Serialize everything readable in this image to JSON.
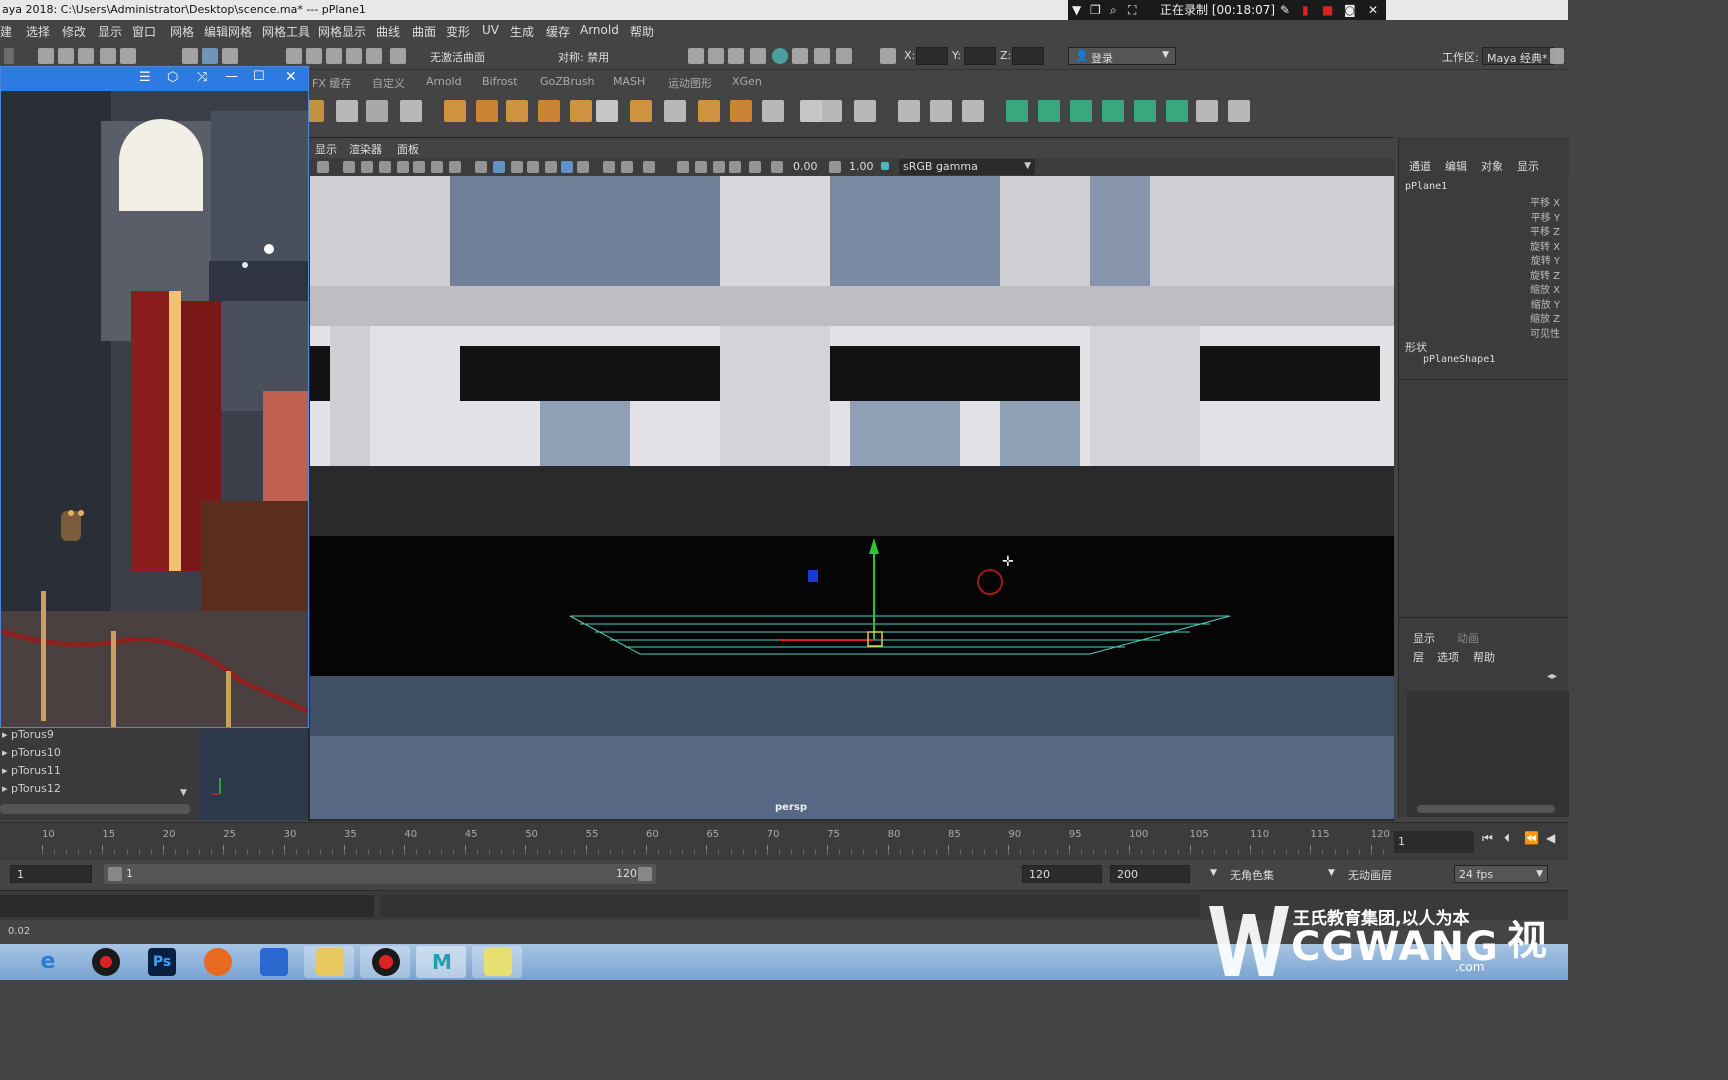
{
  "window": {
    "title": "aya 2018: C:\\Users\\Administrator\\Desktop\\scence.ma*   ---   pPlane1",
    "recording": "正在录制 [00:18:07]"
  },
  "menu": [
    "建",
    "选择",
    "修改",
    "显示",
    "窗口",
    "网格",
    "编辑网格",
    "网格工具",
    "网格显示",
    "曲线",
    "曲面",
    "变形",
    "UV",
    "生成",
    "缓存",
    "Arnold",
    "帮助"
  ],
  "status_line": {
    "no_live_surface": "无激活曲面",
    "symmetry": "对称: 禁用",
    "x_label": "X:",
    "y_label": "Y:",
    "z_label": "Z:",
    "login": "登录",
    "workspace_label": "工作区:",
    "workspace_value": "Maya 经典*"
  },
  "shelf_tabs": [
    "FX 缓存",
    "自定义",
    "Arnold",
    "Bifrost",
    "GoZBrush",
    "MASH",
    "运动图形",
    "XGen"
  ],
  "viewport": {
    "menu": [
      "显示",
      "渲染器",
      "面板"
    ],
    "exposure": "0.00",
    "gamma": "1.00",
    "color_space": "sRGB gamma",
    "camera": "persp"
  },
  "outliner": {
    "items": [
      "pTorus9",
      "pTorus10",
      "pTorus11",
      "pTorus12"
    ]
  },
  "channel_box": {
    "tabs": [
      "通道",
      "编辑",
      "对象",
      "显示"
    ],
    "object": "pPlane1",
    "attributes": [
      "平移 X",
      "平移 Y",
      "平移 Z",
      "旋转 X",
      "旋转 Y",
      "旋转 Z",
      "缩放 X",
      "缩放 Y",
      "缩放 Z",
      "可见性"
    ],
    "shapes_label": "形状",
    "shape_name": "pPlaneShape1",
    "layer_tabs": [
      "显示",
      "动画"
    ],
    "layer_menu": [
      "层",
      "选项",
      "帮助"
    ]
  },
  "timeline": {
    "ticks": [
      "10",
      "15",
      "20",
      "25",
      "30",
      "35",
      "40",
      "45",
      "50",
      "55",
      "60",
      "65",
      "70",
      "75",
      "80",
      "85",
      "90",
      "95",
      "100",
      "105",
      "110",
      "115",
      "120"
    ],
    "current_frame": "1"
  },
  "range": {
    "start": "1",
    "range_start": "1",
    "range_end": "120",
    "end": "120",
    "anim_end": "200",
    "char_set": "无角色集",
    "anim_layer": "无动画层",
    "fps": "24 fps"
  },
  "help_line": "0.02",
  "taskbar": {
    "apps": [
      "ie-icon",
      "record-icon",
      "photoshop-icon",
      "firefox-icon",
      "tiles-icon",
      "explorer-icon",
      "recorder-icon",
      "maya-icon",
      "notepad-icon"
    ],
    "ps_label": "Ps",
    "maya_label": "M"
  },
  "watermark": {
    "slogan": "王氏教育集团,以人为本",
    "brand": "CGWANG",
    "suffix": "视",
    "com": ".com"
  }
}
